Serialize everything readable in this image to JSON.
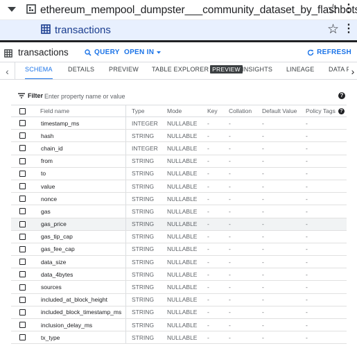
{
  "explorer": {
    "dataset_name": "ethereum_mempool_dumpster___community_dataset_by_flashbots",
    "table_name": "transactions",
    "star_icon": "star-outline-icon",
    "more_icon": "more-vert-icon"
  },
  "toolbar": {
    "title": "transactions",
    "query_label": "QUERY",
    "open_in_label": "OPEN IN",
    "refresh_label": "REFRESH"
  },
  "tabs": {
    "items": [
      "SCHEMA",
      "DETAILS",
      "PREVIEW",
      "TABLE EXPLORER",
      "INSIGHTS",
      "LINEAGE",
      "DATA PR"
    ],
    "active": "SCHEMA",
    "badge": "PREVIEW"
  },
  "filter": {
    "label": "Filter",
    "placeholder": "Enter property name or value",
    "help": "?"
  },
  "schema": {
    "headers": {
      "field_name": "Field name",
      "type": "Type",
      "mode": "Mode",
      "key": "Key",
      "collation": "Collation",
      "default_value": "Default Value",
      "policy_tags": "Policy Tags",
      "help": "?"
    },
    "rows": [
      {
        "name": "timestamp_ms",
        "type": "INTEGER",
        "mode": "NULLABLE",
        "key": "-",
        "collation": "-",
        "default": "-",
        "tags": "-"
      },
      {
        "name": "hash",
        "type": "STRING",
        "mode": "NULLABLE",
        "key": "-",
        "collation": "-",
        "default": "-",
        "tags": "-"
      },
      {
        "name": "chain_id",
        "type": "INTEGER",
        "mode": "NULLABLE",
        "key": "-",
        "collation": "-",
        "default": "-",
        "tags": "-"
      },
      {
        "name": "from",
        "type": "STRING",
        "mode": "NULLABLE",
        "key": "-",
        "collation": "-",
        "default": "-",
        "tags": "-"
      },
      {
        "name": "to",
        "type": "STRING",
        "mode": "NULLABLE",
        "key": "-",
        "collation": "-",
        "default": "-",
        "tags": "-"
      },
      {
        "name": "value",
        "type": "STRING",
        "mode": "NULLABLE",
        "key": "-",
        "collation": "-",
        "default": "-",
        "tags": "-"
      },
      {
        "name": "nonce",
        "type": "STRING",
        "mode": "NULLABLE",
        "key": "-",
        "collation": "-",
        "default": "-",
        "tags": "-"
      },
      {
        "name": "gas",
        "type": "STRING",
        "mode": "NULLABLE",
        "key": "-",
        "collation": "-",
        "default": "-",
        "tags": "-"
      },
      {
        "name": "gas_price",
        "type": "STRING",
        "mode": "NULLABLE",
        "key": "-",
        "collation": "-",
        "default": "-",
        "tags": "-"
      },
      {
        "name": "gas_tip_cap",
        "type": "STRING",
        "mode": "NULLABLE",
        "key": "-",
        "collation": "-",
        "default": "-",
        "tags": "-"
      },
      {
        "name": "gas_fee_cap",
        "type": "STRING",
        "mode": "NULLABLE",
        "key": "-",
        "collation": "-",
        "default": "-",
        "tags": "-"
      },
      {
        "name": "data_size",
        "type": "STRING",
        "mode": "NULLABLE",
        "key": "-",
        "collation": "-",
        "default": "-",
        "tags": "-"
      },
      {
        "name": "data_4bytes",
        "type": "STRING",
        "mode": "NULLABLE",
        "key": "-",
        "collation": "-",
        "default": "-",
        "tags": "-"
      },
      {
        "name": "sources",
        "type": "STRING",
        "mode": "NULLABLE",
        "key": "-",
        "collation": "-",
        "default": "-",
        "tags": "-"
      },
      {
        "name": "included_at_block_height",
        "type": "STRING",
        "mode": "NULLABLE",
        "key": "-",
        "collation": "-",
        "default": "-",
        "tags": "-"
      },
      {
        "name": "included_block_timestamp_ms",
        "type": "STRING",
        "mode": "NULLABLE",
        "key": "-",
        "collation": "-",
        "default": "-",
        "tags": "-"
      },
      {
        "name": "inclusion_delay_ms",
        "type": "STRING",
        "mode": "NULLABLE",
        "key": "-",
        "collation": "-",
        "default": "-",
        "tags": "-"
      },
      {
        "name": "tx_type",
        "type": "STRING",
        "mode": "NULLABLE",
        "key": "-",
        "collation": "-",
        "default": "-",
        "tags": "-"
      }
    ],
    "highlighted_row": "gas_price"
  },
  "colors": {
    "accent": "#1a73e8",
    "selected_row_bg": "#e8f0fe",
    "table_name": "#1a3d8f"
  }
}
